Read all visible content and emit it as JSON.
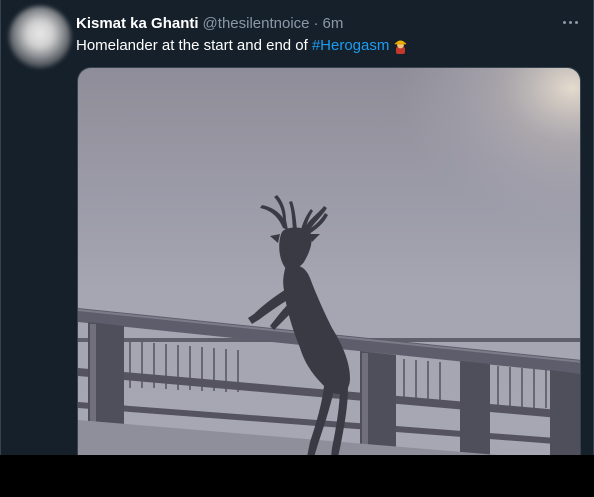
{
  "tweet": {
    "display_name": "Kismat ka Ghanti",
    "handle": "@thesilentnoice",
    "separator": "·",
    "timestamp": "6m",
    "text": "Homelander at the start and end of",
    "hashtag": "#Herogasm",
    "emoji": "construction-worker-emoji",
    "more_icon": "more-horizontal-icon"
  },
  "colors": {
    "background": "#15202b",
    "accent": "#1d9bf0",
    "secondary_text": "#8b98a5",
    "border": "#38444d"
  },
  "media": {
    "subject": "deer-silhouette",
    "setting": "foggy-bridge-railing"
  }
}
